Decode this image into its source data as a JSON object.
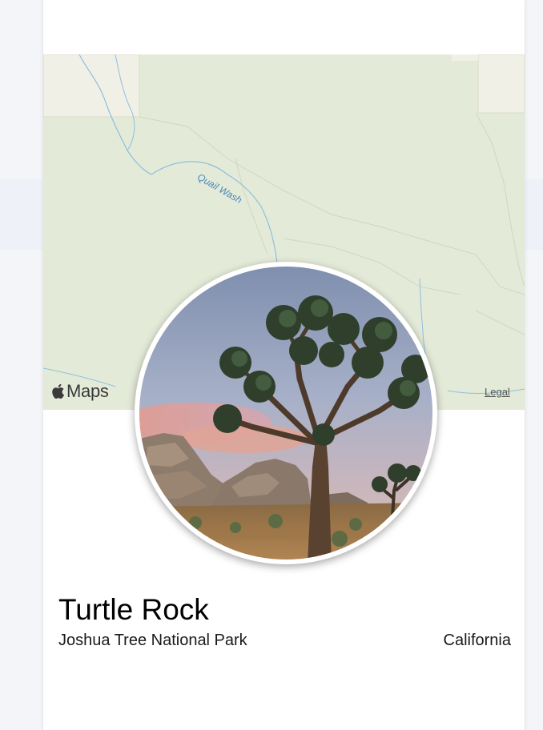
{
  "map": {
    "attribution_label": "Maps",
    "legal_label": "Legal",
    "feature_label": "Quail Wash"
  },
  "landmark": {
    "name": "Turtle Rock",
    "park": "Joshua Tree National Park",
    "state": "California",
    "photo_icon": "joshua-tree-photo"
  },
  "colors": {
    "map_background": "#e4ead8",
    "map_water": "#7fb3d5",
    "title_text": "#000000"
  }
}
